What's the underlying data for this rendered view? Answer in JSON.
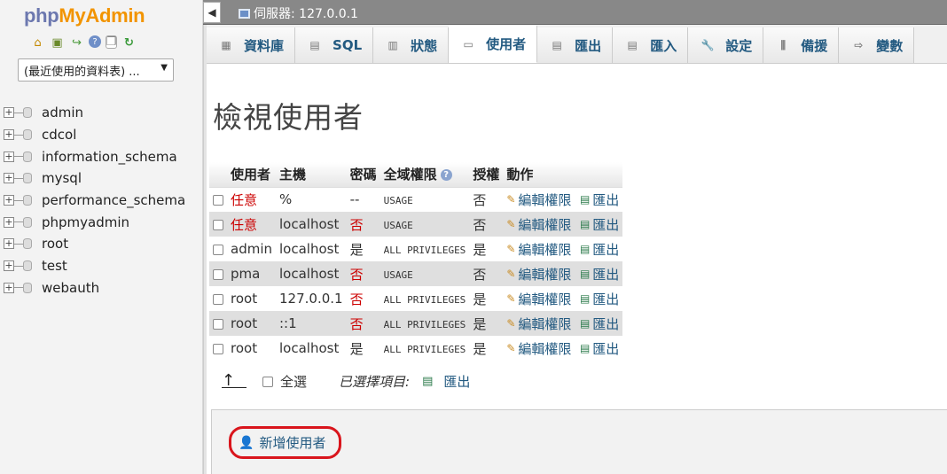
{
  "nav": {
    "logo_php": "php",
    "logo_myadmin": "MyAdmin",
    "recent_tables": "(最近使用的資料表) ...",
    "databases": [
      "admin",
      "cdcol",
      "information_schema",
      "mysql",
      "performance_schema",
      "phpmyadmin",
      "root",
      "test",
      "webauth"
    ],
    "icons": [
      "home-icon",
      "logout-icon",
      "query-window-icon",
      "docs-icon",
      "sql-docs-icon",
      "reload-icon"
    ]
  },
  "server": {
    "label": "伺服器: 127.0.0.1"
  },
  "tabs": [
    {
      "label": "資料庫",
      "icon": "database-icon"
    },
    {
      "label": "SQL",
      "icon": "sql-icon"
    },
    {
      "label": "狀態",
      "icon": "status-icon"
    },
    {
      "label": "使用者",
      "icon": "users-icon",
      "active": true
    },
    {
      "label": "匯出",
      "icon": "export-icon"
    },
    {
      "label": "匯入",
      "icon": "import-icon"
    },
    {
      "label": "設定",
      "icon": "settings-icon"
    },
    {
      "label": "備援",
      "icon": "replication-icon"
    },
    {
      "label": "變數",
      "icon": "variables-icon"
    }
  ],
  "main": {
    "title": "檢視使用者",
    "columns": [
      "",
      "使用者",
      "主機",
      "密碼",
      "全域權限",
      "授權",
      "動作"
    ],
    "rows": [
      {
        "user": "任意",
        "user_red": true,
        "host": "%",
        "password": "--",
        "password_red": false,
        "privileges": "USAGE",
        "grant": "否"
      },
      {
        "user": "任意",
        "user_red": true,
        "host": "localhost",
        "password": "否",
        "password_red": true,
        "privileges": "USAGE",
        "grant": "否"
      },
      {
        "user": "admin",
        "user_red": false,
        "host": "localhost",
        "password": "是",
        "password_red": false,
        "privileges": "ALL PRIVILEGES",
        "grant": "是"
      },
      {
        "user": "pma",
        "user_red": false,
        "host": "localhost",
        "password": "否",
        "password_red": true,
        "privileges": "USAGE",
        "grant": "否"
      },
      {
        "user": "root",
        "user_red": false,
        "host": "127.0.0.1",
        "password": "否",
        "password_red": true,
        "privileges": "ALL PRIVILEGES",
        "grant": "是"
      },
      {
        "user": "root",
        "user_red": false,
        "host": "::1",
        "password": "否",
        "password_red": true,
        "privileges": "ALL PRIVILEGES",
        "grant": "是"
      },
      {
        "user": "root",
        "user_red": false,
        "host": "localhost",
        "password": "是",
        "password_red": false,
        "privileges": "ALL PRIVILEGES",
        "grant": "是"
      }
    ],
    "edit_label": "編輯權限",
    "export_label": "匯出",
    "select_all": "全選",
    "with_selected": "已選擇項目:",
    "export_selected": "匯出",
    "add_user": "新增使用者"
  },
  "colors": {
    "link": "#235a81",
    "danger": "#cc0000",
    "highlight_ring": "#d9151c",
    "logo_php": "#6c78af",
    "logo_myadmin": "#f29400"
  }
}
